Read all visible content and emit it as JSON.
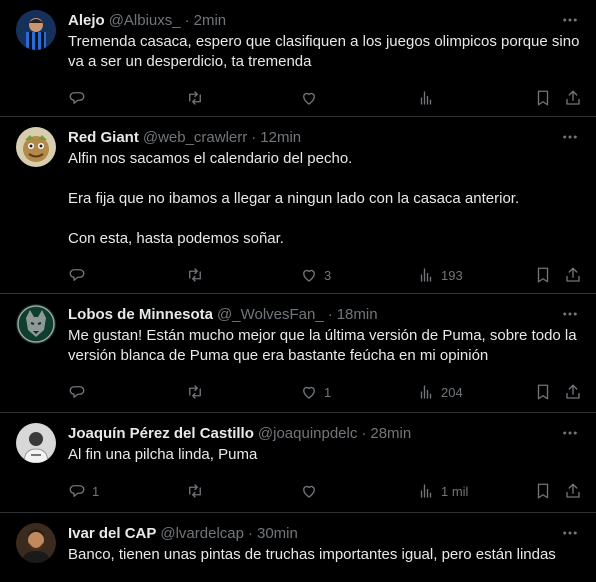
{
  "tweets": [
    {
      "name": "Alejo",
      "handle": "@Albiuxs_",
      "dot": "·",
      "time": "2min",
      "paragraphs": [
        "Tremenda casaca, espero que clasifiquen a los juegos olimpicos porque sino va a ser un desperdicio, ta tremenda"
      ],
      "replies": "",
      "reposts": "",
      "likes": "",
      "views": ""
    },
    {
      "name": "Red Giant",
      "handle": "@web_crawlerr",
      "dot": "·",
      "time": "12min",
      "paragraphs": [
        "Alfin nos sacamos el calendario del pecho.",
        "Era fija que no ibamos a llegar a ningun lado con la casaca anterior.",
        "Con esta, hasta podemos soñar."
      ],
      "replies": "",
      "reposts": "",
      "likes": "3",
      "views": "193"
    },
    {
      "name": "Lobos de Minnesota",
      "handle": "@_WolvesFan_",
      "dot": "·",
      "time": "18min",
      "paragraphs": [
        "Me gustan! Están mucho mejor que la última versión de Puma, sobre todo la versión blanca de Puma que era bastante feúcha en mi opinión"
      ],
      "replies": "",
      "reposts": "",
      "likes": "1",
      "views": "204"
    },
    {
      "name": "Joaquín Pérez del Castillo",
      "handle": "@joaquinpdelc",
      "dot": "·",
      "time": "28min",
      "paragraphs": [
        "Al fin una pilcha linda, Puma"
      ],
      "replies": "1",
      "reposts": "",
      "likes": "",
      "views": "1 mil"
    },
    {
      "name": "Ivar del CAP",
      "handle": "@lvardelcap",
      "dot": "·",
      "time": "30min",
      "paragraphs": [
        "Banco, tienen unas pintas de truchas importantes igual, pero están lindas"
      ],
      "replies": "",
      "reposts": "",
      "likes": "",
      "views": ""
    }
  ],
  "colors": {
    "background": "#000000",
    "text": "#e7e9ea",
    "muted": "#71767b",
    "divider": "#2f3336"
  },
  "icons": {
    "reply": "speech-bubble-icon",
    "repost": "repost-arrows-icon",
    "like": "heart-icon",
    "views": "bar-chart-icon",
    "bookmark": "bookmark-icon",
    "share": "share-upload-icon",
    "more": "three-dots-icon"
  }
}
